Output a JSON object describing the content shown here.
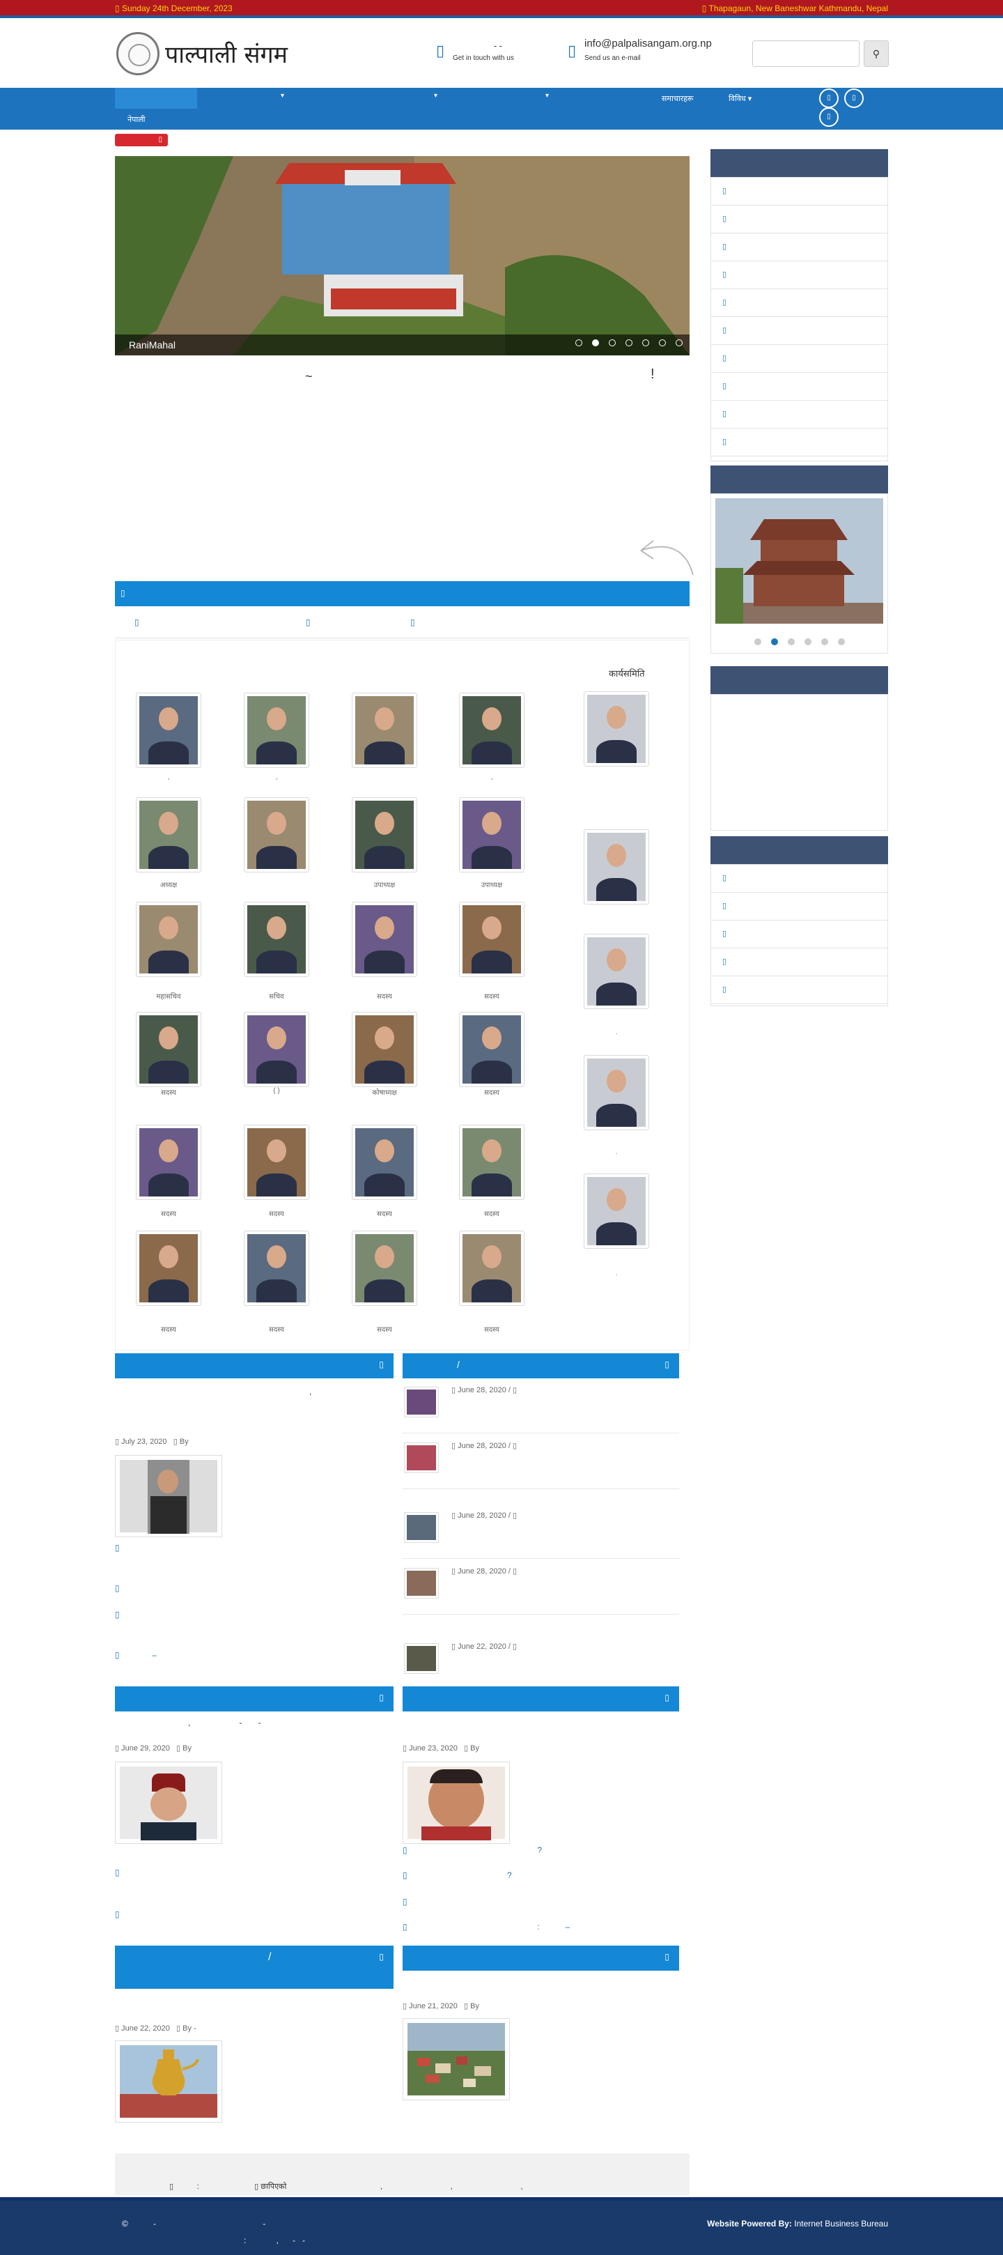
{
  "topbar": {
    "date": "Sunday 24th December, 2023",
    "address": "Thapagaun, New Baneshwar Kathmandu, Nepal",
    "date_icon": "calendar-icon",
    "address_icon": "map-marker-icon"
  },
  "header": {
    "logo_text": "पाल्पाली संगम",
    "contact": {
      "title": "- -",
      "subtitle": "Get in touch with us",
      "icon": "phone-icon"
    },
    "email": {
      "title": "info@palpalisangam.org.np",
      "subtitle": "Send us an e-mail",
      "icon": "envelope-icon"
    },
    "search_icon": "search-icon"
  },
  "nav": {
    "item1": "नेपाली",
    "item2": "समाचारहरू",
    "item3": "विविध"
  },
  "slider": {
    "caption": "RaniMahal",
    "slides": 8,
    "active": 2
  },
  "notice": {
    "left": "~",
    "right": "!"
  },
  "members": {
    "title": "कार्यसमिति",
    "captions": [
      ",",
      ",",
      "",
      ",",
      "अध्यक्ष",
      "",
      "उपाध्यक्ष",
      "उपाध्यक्ष",
      "महासचिव",
      "सचिव",
      "सदस्य",
      "सदस्य",
      "सदस्य",
      "( )",
      "कोषाध्यक्ष",
      "सदस्य",
      "सदस्य",
      "सदस्य",
      "सदस्य",
      "सदस्य",
      "सदस्य",
      "सदस्य",
      "सदस्य",
      "सदस्य",
      "सदस्य",
      "सदस्य",
      "सदस्य",
      "सदस्य"
    ],
    "side_captions": [
      ".",
      ".",
      "."
    ]
  },
  "news": {
    "left1": {
      "dot": ",",
      "date": "July 23, 2020",
      "by": "By"
    },
    "right1": {
      "title": "/",
      "items": [
        {
          "date": "June 28, 2020 /"
        },
        {
          "date": "June 28, 2020 /"
        },
        {
          "date": "June 28, 2020 /"
        },
        {
          "date": "June 28, 2020 /"
        },
        {
          "date": "June 22, 2020 /"
        }
      ]
    },
    "left2": {
      "date": "June 29, 2020",
      "by": "By"
    },
    "right2": {
      "date": "June 23, 2020",
      "by": "By",
      "q": "?"
    },
    "left3": {
      "title": "/",
      "date": "June 22, 2020",
      "by": "By -"
    },
    "right3": {
      "date": "June 21, 2020",
      "by": "By"
    }
  },
  "bottom_strip": {
    "text": "छापिएको"
  },
  "footer": {
    "copyright": "©",
    "powered_label": "Website Powered By:",
    "powered_by": "Internet Business Bureau"
  }
}
